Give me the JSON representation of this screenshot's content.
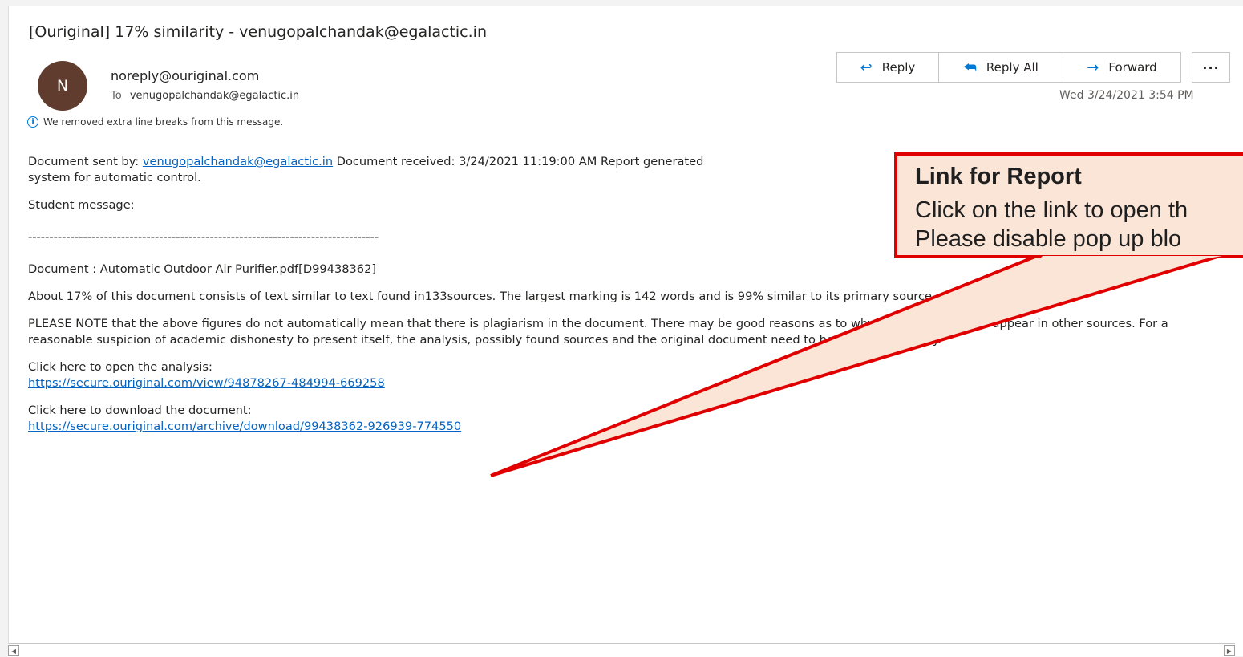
{
  "email": {
    "subject": "[Ouriginal] 17% similarity - venugopalchandak@egalactic.in",
    "avatar_initial": "N",
    "sender": "noreply@ouriginal.com",
    "to_label": "To",
    "to_address": "venugopalchandak@egalactic.in",
    "info_message": "We removed extra line breaks from this message.",
    "date": "Wed 3/24/2021 3:54 PM"
  },
  "actions": {
    "reply": "Reply",
    "reply_all": "Reply All",
    "forward": "Forward",
    "more": "···"
  },
  "body": {
    "sent_by_prefix": "Document sent by: ",
    "sent_by_link": "venugopalchandak@egalactic.in",
    "sent_by_suffix": " Document received: 3/24/2021 11:19:00 AM Report generated",
    "line2": "system for automatic control.",
    "student_message": "Student message:",
    "separator": "-----------------------------------------------------------------------------------",
    "document": "Document : Automatic Outdoor Air Purifier.pdf[D99438362]",
    "about": "About 17% of this document consists of text similar to text found in133sources. The largest marking is 142 words and is 99% similar to its primary source.",
    "note": "PLEASE NOTE that the above figures do not automatically mean that there is plagiarism in the document. There may be good reasons as to why parts of a text also appear in other sources. For a reasonable suspicion of academic dishonesty to present itself, the analysis, possibly found sources and the original document need to be examined closely.",
    "open_analysis_label": "Click here to open the analysis:",
    "open_analysis_link": "https://secure.ouriginal.com/view/94878267-484994-669258",
    "download_label": "Click here to download the document:",
    "download_link": "https://secure.ouriginal.com/archive/download/99438362-926939-774550"
  },
  "callout": {
    "title": "Link for Report",
    "line1": "Click on the link to open th",
    "line2": "Please disable pop up blo",
    "fill_color": "#fbe5d6",
    "border_color": "#e00000"
  },
  "scrollbar": {
    "left_arrow": "◀",
    "right_arrow": "▶"
  }
}
